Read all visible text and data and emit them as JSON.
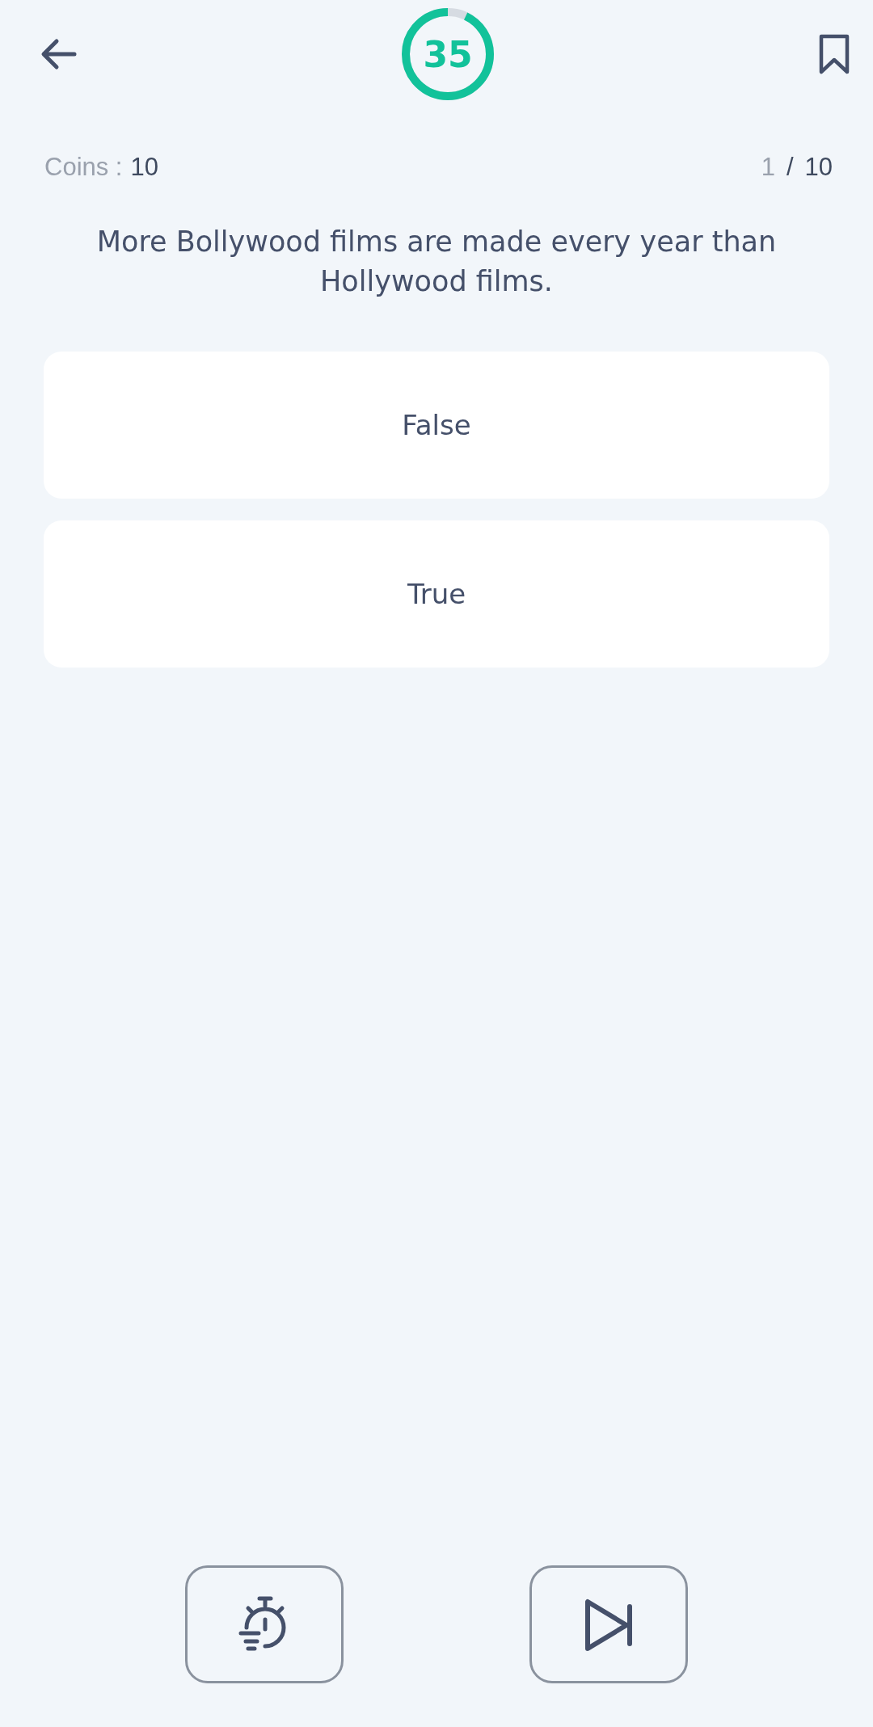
{
  "timer": {
    "value": "35"
  },
  "coins": {
    "label": "Coins :",
    "value": "10"
  },
  "progress": {
    "current": "1",
    "separator": "/",
    "total": "10"
  },
  "question": "More Bollywood films are made every year than Hollywood films.",
  "options": [
    {
      "label": "False"
    },
    {
      "label": "True"
    }
  ]
}
